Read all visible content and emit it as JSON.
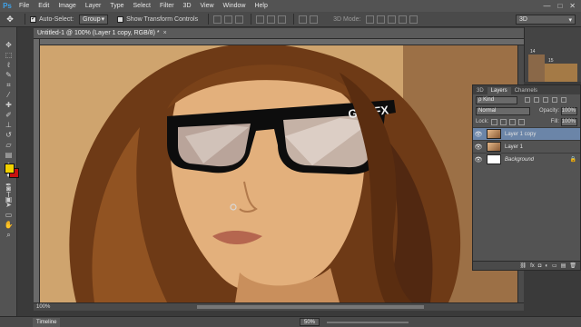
{
  "app": {
    "logo": "Ps"
  },
  "menu": [
    "File",
    "Edit",
    "Image",
    "Layer",
    "Type",
    "Select",
    "Filter",
    "3D",
    "View",
    "Window",
    "Help"
  ],
  "window_controls": {
    "minimize": "—",
    "maximize": "□",
    "close": "✕"
  },
  "options": {
    "auto_select_label": "Auto-Select:",
    "auto_select_value": "Group",
    "transform_label": "Show Transform Controls",
    "mode3d_label": "3D Mode:",
    "workspace_value": "3D"
  },
  "document": {
    "tab_title": "Untitled-1 @ 100% (Layer 1 copy, RGB/8) *",
    "close": "×",
    "status_zoom": "100%"
  },
  "canvas_image": {
    "logo_text": "GLOFX",
    "colors": {
      "background": "#cda26b",
      "hair": "#6e3a16",
      "skin": "#e3b07c",
      "frames": "#0d0d0d"
    }
  },
  "mini_panel": {
    "nums": [
      "14",
      "15"
    ]
  },
  "layers_panel": {
    "tabs": [
      "3D",
      "Layers",
      "Channels"
    ],
    "kind_label": "ρ Kind",
    "blend_mode": "Normal",
    "opacity_label": "Opacity:",
    "opacity_value": "100%",
    "lock_label": "Lock:",
    "fill_label": "Fill:",
    "fill_value": "100%",
    "layers": [
      {
        "name": "Layer 1 copy",
        "selected": true,
        "thumb": "photo"
      },
      {
        "name": "Layer 1",
        "selected": false,
        "thumb": "photo"
      },
      {
        "name": "Background",
        "selected": false,
        "thumb": "white",
        "locked": true
      }
    ],
    "bottom_icons": [
      "fx",
      "◘",
      "◐",
      "▭",
      "▤",
      "🗑"
    ]
  },
  "bottom": {
    "timeline_label": "Timeline",
    "zoom_value": "50%"
  }
}
